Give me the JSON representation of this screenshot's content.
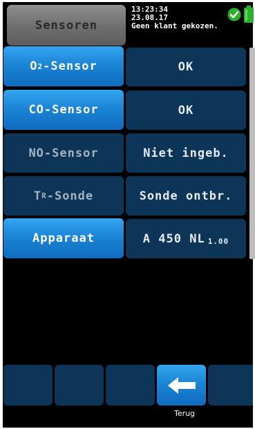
{
  "header": {
    "title": "Sensoren",
    "time": "13:23:34",
    "date": "23.08.17",
    "customer": "Geen klant gekozen.",
    "status_icon": "check-circle-icon",
    "battery_icon": "battery-icon"
  },
  "rows": [
    {
      "label_main": "O",
      "label_sub": "2",
      "label_rest": "-Sensor",
      "value": "OK",
      "active": true
    },
    {
      "label_main": "CO-Sensor",
      "value": "OK",
      "active": true
    },
    {
      "label_main": "NO-Sensor",
      "value": "Niet ingeb.",
      "active": false
    },
    {
      "label_main": "T",
      "label_sub": "R",
      "label_rest": "-Sonde",
      "value": "Sonde ontbr.",
      "active": false
    },
    {
      "label_main": "Apparaat",
      "value": "A 450 NL",
      "value_sub": "1.00",
      "active": true
    }
  ],
  "footer": {
    "back_label": "Terug",
    "back_icon": "arrow-left-icon"
  },
  "colors": {
    "active_button": "#1a82d4",
    "inactive_button": "#0c3558",
    "header_box": "#707070",
    "ok_green": "#2bb02b"
  }
}
